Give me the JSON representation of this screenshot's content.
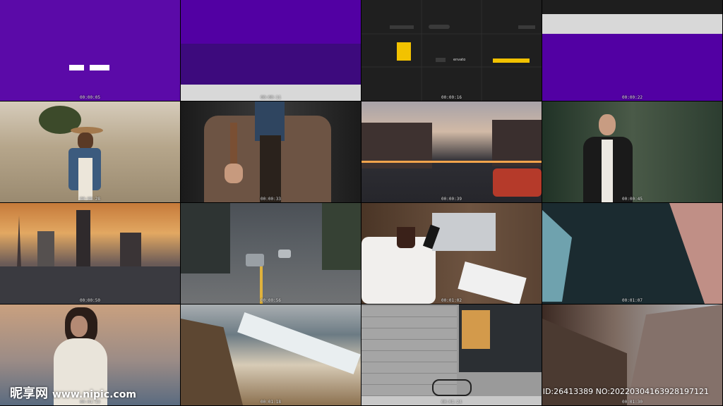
{
  "timestamps": [
    "00:00:05",
    "00:00:11",
    "00:00:16",
    "00:00:22",
    "00:00:28",
    "00:00:33",
    "00:00:39",
    "00:00:45",
    "00:00:50",
    "00:00:56",
    "00:01:02",
    "00:01:07",
    "00:01:13",
    "00:01:18",
    "00:01:24",
    "00:01:30"
  ],
  "lower_thirds": {
    "envato": "envato"
  },
  "watermark": {
    "logo_text": "昵享网",
    "url": "www.nipic.com",
    "id_text": "ID:26413389 NO:20220304163928197121"
  },
  "colors": {
    "purple": "#5b0aa8",
    "yellow": "#f2c200"
  }
}
